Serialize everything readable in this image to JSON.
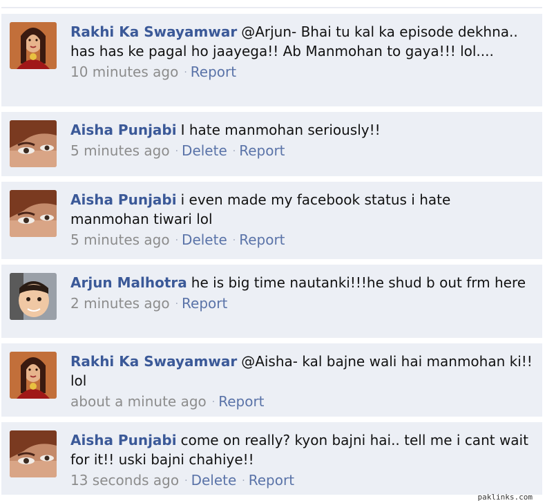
{
  "comments": [
    {
      "author": "Rakhi Ka Swayamwar",
      "text": "@Arjun- Bhai tu kal ka episode dekhna.. has has ke pagal ho jaayega!! Ab Manmohan to gaya!!! lol....",
      "time": "10 minutes ago",
      "actions": [
        "Report"
      ],
      "avatar": "rakhi-avatar"
    },
    {
      "author": "Aisha Punjabi",
      "text": "I hate manmohan seriously!!",
      "time": "5 minutes ago",
      "actions": [
        "Delete",
        "Report"
      ],
      "avatar": "aisha-avatar"
    },
    {
      "author": "Aisha Punjabi",
      "text": "i even made my facebook status i hate manmohan tiwari lol",
      "time": "5 minutes ago",
      "actions": [
        "Delete",
        "Report"
      ],
      "avatar": "aisha-avatar"
    },
    {
      "author": "Arjun Malhotra",
      "text": "he is big time nautanki!!!he shud b out frm here",
      "time": "2 minutes ago",
      "actions": [
        "Report"
      ],
      "avatar": "arjun-avatar"
    },
    {
      "author": "Rakhi Ka Swayamwar",
      "text": "@Aisha- kal bajne wali hai manmohan ki!! lol",
      "time": "about a minute ago",
      "actions": [
        "Report"
      ],
      "avatar": "rakhi-avatar"
    },
    {
      "author": "Aisha Punjabi",
      "text": "come on really? kyon bajni hai.. tell me i cant wait for it!! uski bajni chahiye!!",
      "time": "13 seconds ago",
      "actions": [
        "Delete",
        "Report"
      ],
      "avatar": "aisha-avatar"
    }
  ],
  "watermark": "paklinks.com",
  "colors": {
    "author": "#3b5998",
    "link": "#5a73a8",
    "timestamp": "#8c8c8c",
    "row_bg": "#eceff5"
  }
}
